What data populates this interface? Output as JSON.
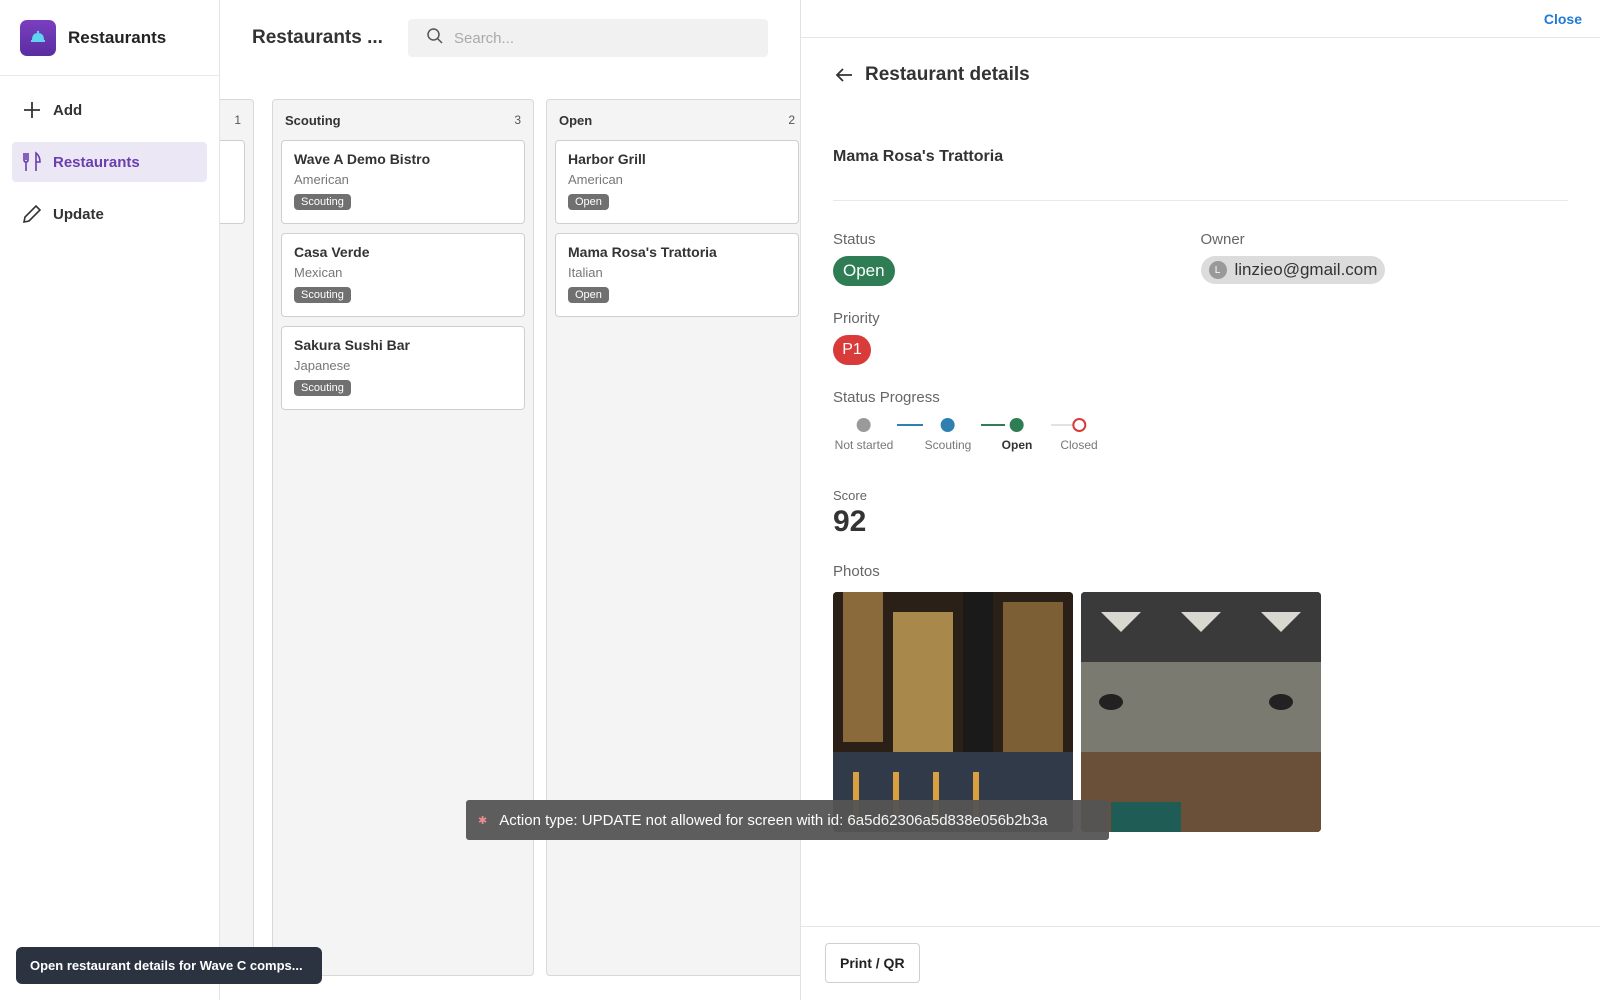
{
  "app": {
    "title": "Restaurants"
  },
  "sidebar": {
    "items": [
      {
        "label": "Add",
        "icon": "plus-icon"
      },
      {
        "label": "Restaurants",
        "icon": "fork-knife-icon",
        "active": true
      },
      {
        "label": "Update",
        "icon": "pencil-icon"
      }
    ]
  },
  "main": {
    "title": "Restaurants ...",
    "search_placeholder": "Search...",
    "columns": [
      {
        "name": "",
        "count": "1",
        "cards": []
      },
      {
        "name": "Scouting",
        "count": "3",
        "cards": [
          {
            "title": "Wave A Demo Bistro",
            "cuisine": "American",
            "tag": "Scouting"
          },
          {
            "title": "Casa Verde",
            "cuisine": "Mexican",
            "tag": "Scouting"
          },
          {
            "title": "Sakura Sushi Bar",
            "cuisine": "Japanese",
            "tag": "Scouting"
          }
        ]
      },
      {
        "name": "Open",
        "count": "2",
        "cards": [
          {
            "title": "Harbor Grill",
            "cuisine": "American",
            "tag": "Open"
          },
          {
            "title": "Mama Rosa's Trattoria",
            "cuisine": "Italian",
            "tag": "Open"
          }
        ]
      }
    ]
  },
  "detail": {
    "close_label": "Close",
    "title": "Restaurant details",
    "restaurant_name": "Mama Rosa's Trattoria",
    "status_label": "Status",
    "status_value": "Open",
    "owner_label": "Owner",
    "owner_initial": "L",
    "owner_email": "linzieo@gmail.com",
    "priority_label": "Priority",
    "priority_value": "P1",
    "progress_label": "Status Progress",
    "steps": [
      "Not started",
      "Scouting",
      "Open",
      "Closed"
    ],
    "current_step": "Open",
    "score_label": "Score",
    "score_value": "92",
    "photos_label": "Photos",
    "print_label": "Print / QR"
  },
  "toasts": {
    "error": "Action type: UPDATE not allowed for screen with id: 6a5d62306a5d838e056b2b3a",
    "bottom": "Open restaurant details for Wave C comps..."
  },
  "colors": {
    "accent": "#6a3fae",
    "open_green": "#2e7d55",
    "scouting_blue": "#2f7fb0",
    "priority_red": "#d93a3a",
    "link_blue": "#1e7bd6"
  }
}
